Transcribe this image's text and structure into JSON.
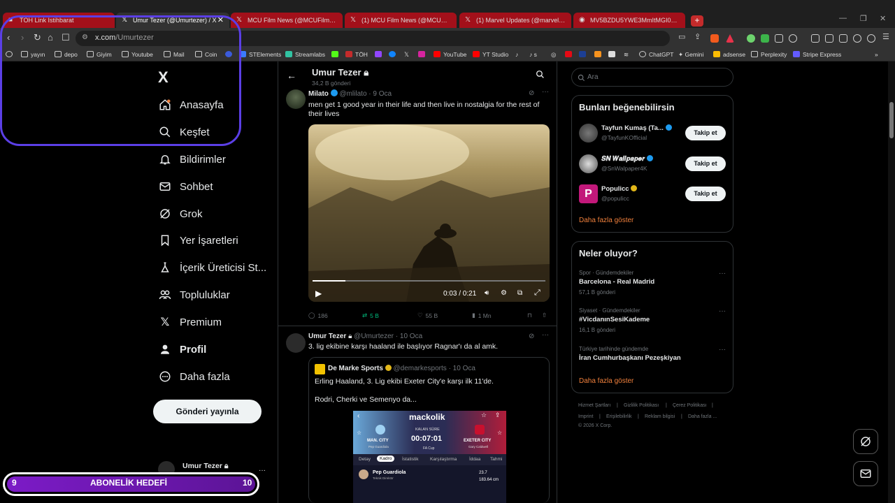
{
  "browser": {
    "tabs": [
      {
        "title": "TÖH Link İstihbarat",
        "style": "red"
      },
      {
        "title": "Umur Tezer (@Umurtezer) / X",
        "style": "active"
      },
      {
        "title": "MCU Film News (@MCUFilmNews) /",
        "style": "red"
      },
      {
        "title": "(1) MCU Film News (@MCUFilmNew",
        "style": "red"
      },
      {
        "title": "(1) Marvel Updates (@marvel_updat",
        "style": "red"
      },
      {
        "title": "MV5BZDU5YWE3MmItMGI0Ny00M",
        "style": "red"
      }
    ],
    "new_tab": "+",
    "url_domain": "x.com",
    "url_path": "/Umurtezer",
    "bookmarks": [
      "yayın",
      "depo",
      "Giyim",
      "Youtube",
      "Mail",
      "Coin",
      "STElements",
      "Streamlabs",
      "TÖH",
      "YouTube",
      "YT Studio",
      "ChatGPT",
      "Gemini",
      "adsense",
      "Perplexity",
      "Stripe Express"
    ],
    "bookmarks_overflow": "»"
  },
  "sidebar": {
    "logo": "X",
    "items": [
      {
        "label": "Anasayfa",
        "icon": "home-icon"
      },
      {
        "label": "Keşfet",
        "icon": "search-icon"
      },
      {
        "label": "Bildirimler",
        "icon": "bell-icon"
      },
      {
        "label": "Sohbet",
        "icon": "mail-icon"
      },
      {
        "label": "Grok",
        "icon": "grok-icon"
      },
      {
        "label": "Yer İşaretleri",
        "icon": "bookmark-icon"
      },
      {
        "label": "İçerik Üreticisi St...",
        "icon": "flask-icon"
      },
      {
        "label": "Topluluklar",
        "icon": "people-icon"
      },
      {
        "label": "Premium",
        "icon": "x-icon"
      },
      {
        "label": "Profil",
        "icon": "user-icon"
      },
      {
        "label": "Daha fazla",
        "icon": "more-circle-icon"
      }
    ],
    "post_button": "Gönderi yayınla",
    "account_name": "Umur Tezer",
    "account_more": "···"
  },
  "overlay": {
    "goal_label": "ABONELİK HEDEFİ",
    "goal_start": "9",
    "goal_end": "10"
  },
  "header": {
    "name": "Umur Tezer",
    "posts": "34,2 B gönderi"
  },
  "tweets": [
    {
      "name": "Milato",
      "handle": "@mlilato",
      "date": "· 9 Oca",
      "text": "men get 1 good year in their life and then live in nostalgia for the rest of their lives",
      "video_time": "0:03 / 0:21",
      "video_progress": 0.14,
      "replies": "186",
      "reposts": "5 B",
      "likes": "55 B",
      "views": "1 Mn"
    },
    {
      "name": "Umur Tezer",
      "handle": "@Umurtezer",
      "date": "· 10 Oca",
      "text": "3. lig ekibine karşı haaland ile başlıyor Ragnar'ı da al amk.",
      "quote": {
        "name": "De Marke Sports",
        "handle": "@demarkesports",
        "date": "· 10 Oca",
        "line1": "Erling Haaland, 3. Lig ekibi Exeter City'e karşı ilk 11'de.",
        "line2": "Rodri, Cherki ve Semenyo da..."
      },
      "embed": {
        "brand": "mackolik",
        "kalan": "KALAN SÜRE",
        "time": "00:07:01",
        "cup": "FA Cup",
        "home": "MAN. CITY",
        "home_coach": "Pep Guardiola",
        "away": "EXETER CITY",
        "away_coach": "Gary Caldwell",
        "tabs": [
          "Detay",
          "Kadro",
          "İstatistik",
          "Karşılaştırma",
          "İddaa",
          "Tahmi"
        ],
        "person": "Pep Guardiola",
        "person_role": "Teknik Direktör",
        "stat1": "23.7",
        "stat2": "183.64 cm"
      }
    }
  ],
  "right": {
    "search_placeholder": "Ara",
    "suggest_title": "Bunları beğenebilirsin",
    "suggestions": [
      {
        "name": "Tayfun Kumaş (Ta...",
        "handle": "@TayfunKOfficial",
        "button": "Takip et"
      },
      {
        "name": "𝑺𝑵 𝑾𝒂𝒍𝒍𝒑𝒂𝒑𝒆𝒓",
        "handle": "@SnWalpaper4K",
        "button": "Takip et"
      },
      {
        "name": "Populicc",
        "handle": "@populicc",
        "button": "Takip et"
      }
    ],
    "show_more": "Daha fazla göster",
    "trends_title": "Neler oluyor?",
    "trends": [
      {
        "category": "Spor · Gündemdekiler",
        "name": "Barcelona - Real Madrid",
        "count": "57,1 B gönderi"
      },
      {
        "category": "Siyaset · Gündemdekiler",
        "name": "#VicdanınSesiKademe",
        "count": "16,1 B gönderi"
      },
      {
        "category": "Türkiye tarihinde gündemde",
        "name": "İran Cumhurbaşkanı Pezeşkiyan",
        "count": ""
      }
    ],
    "footer": [
      "Hizmet Şartları",
      "|",
      "Gizlilik Politikası",
      "|",
      "Çerez Politikası",
      "|",
      "Imprint",
      "|",
      "Erişilebilirlik",
      "|",
      "Reklam bilgisi",
      "|",
      "Daha fazla ...",
      "© 2026 X Corp."
    ]
  },
  "colors": {
    "accent_orange": "#f0803c",
    "repost_green": "#00ba7c",
    "verified_blue": "#1d9bf0",
    "verified_gold": "#e2b719",
    "overlay_purple": "#5b3fe6"
  }
}
